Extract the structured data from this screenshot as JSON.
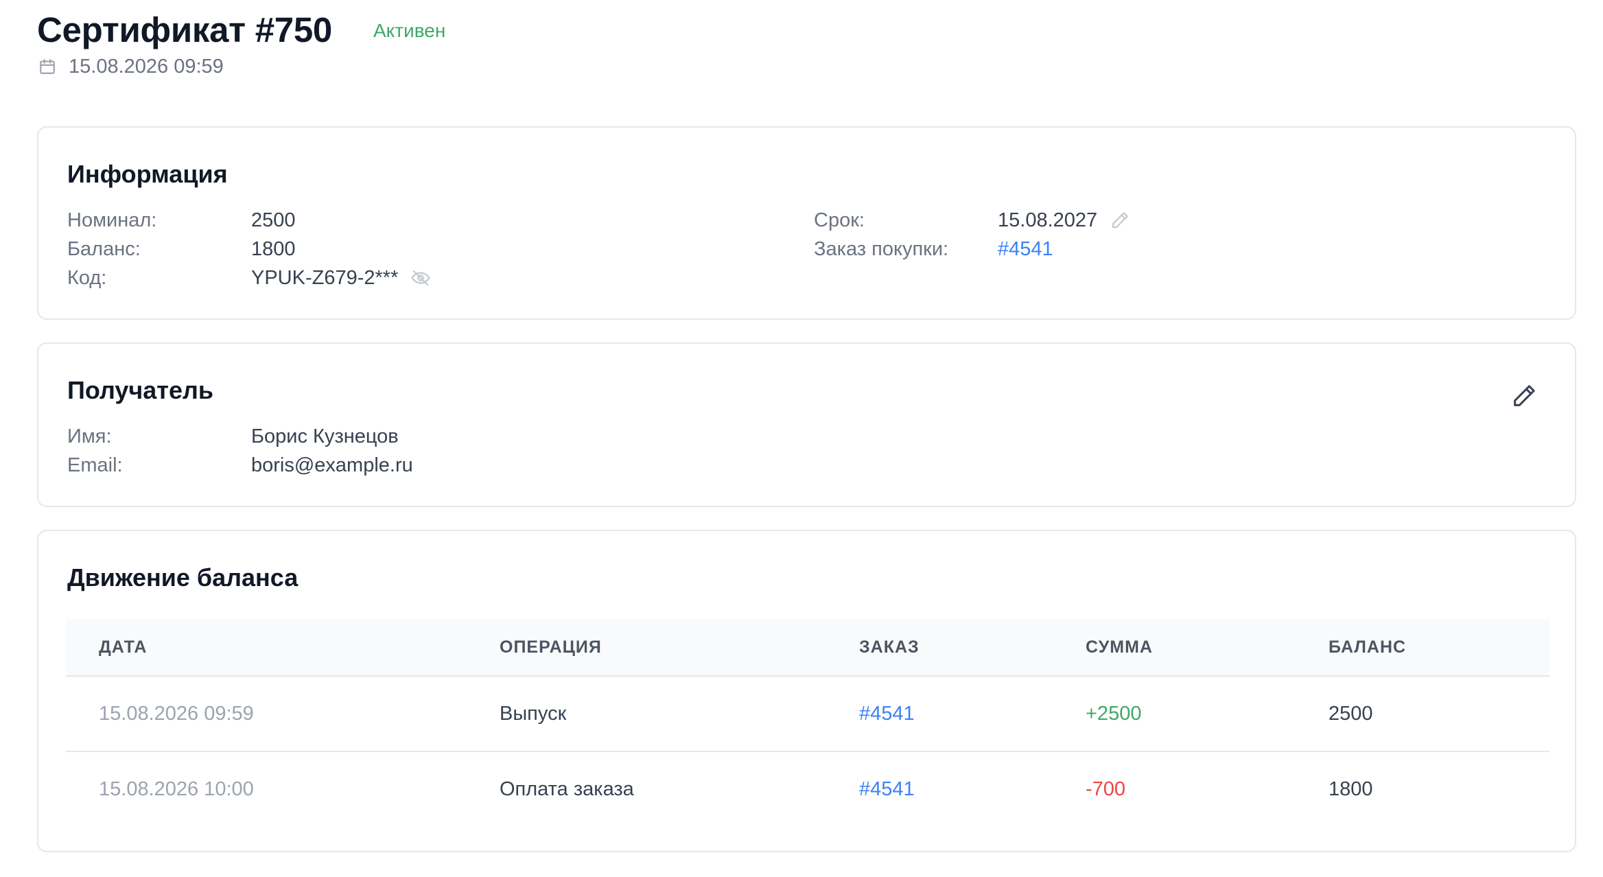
{
  "header": {
    "title": "Сертификат #750",
    "status": "Активен",
    "created_at": "15.08.2026 09:59"
  },
  "info": {
    "title": "Информация",
    "left": [
      {
        "label": "Номинал:",
        "value": "2500"
      },
      {
        "label": "Баланс:",
        "value": "1800"
      },
      {
        "label": "Код:",
        "value": "YPUK-Z679-2***"
      }
    ],
    "right": [
      {
        "label": "Срок:",
        "value": "15.08.2027"
      },
      {
        "label": "Заказ покупки:",
        "value": "#4541"
      }
    ]
  },
  "recipient": {
    "title": "Получатель",
    "rows": [
      {
        "label": "Имя:",
        "value": "Борис Кузнецов"
      },
      {
        "label": "Email:",
        "value": "boris@example.ru"
      }
    ]
  },
  "movement": {
    "title": "Движение баланса",
    "columns": [
      "ДАТА",
      "ОПЕРАЦИЯ",
      "ЗАКАЗ",
      "СУММА",
      "БАЛАНС"
    ],
    "rows": [
      {
        "date": "15.08.2026 09:59",
        "operation": "Выпуск",
        "order": "#4541",
        "amount": "+2500",
        "balance": "2500"
      },
      {
        "date": "15.08.2026 10:00",
        "operation": "Оплата заказа",
        "order": "#4541",
        "amount": "-700",
        "balance": "1800"
      }
    ]
  },
  "colors": {
    "status_green": "#3fa768",
    "link_blue": "#3b82f6",
    "negative_red": "#ef4444"
  },
  "icons": {
    "date": "calendar-icon",
    "code_toggle": "eye-off-icon",
    "term_edit": "pencil-icon",
    "recipient_edit": "pencil-icon"
  }
}
